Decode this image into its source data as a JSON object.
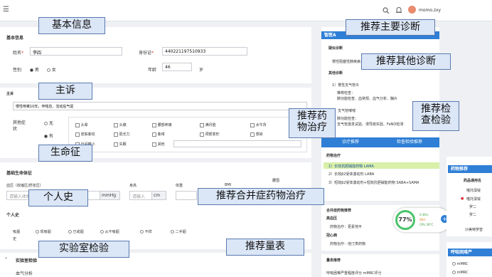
{
  "header": {
    "menu_icon": "menu-icon",
    "username": "momo.zxy",
    "icons": [
      "search-icon",
      "bell-icon",
      "avatar"
    ]
  },
  "basic_info": {
    "section_title": "基本信息",
    "name_label": "姓名",
    "name_required": "*",
    "name_value": "李四",
    "id_label": "身份证",
    "id_required": "*",
    "id_value": "440221197510933",
    "gender_label": "性别",
    "gender_male": "男",
    "gender_female": "女",
    "age_label": "年龄",
    "age_value": "46",
    "age_unit": "岁"
  },
  "complaint": {
    "section_title": "主诉",
    "value": "慢性咳嗽10年，伴喘息、活动后气促",
    "other_symptoms_label": "其他症状",
    "opt_none": "无",
    "opt_yes": "有",
    "symptoms": [
      "头晕",
      "头痛",
      "腰部疼痛",
      "满月脸",
      "水牛背",
      "皮肤紫纹",
      "肌无力",
      "紫绀",
      "颈部变形",
      "感染",
      "日间嗜小",
      "失眠",
      "其他"
    ]
  },
  "vitals": {
    "section_title": "基础生命体征",
    "bp_label": "血压（收缩压/舒张压）",
    "bp_placeholder": "请输入收缩压/舒张压",
    "bp_unit": "mmHg",
    "height_label": "身高",
    "height_placeholder": "请输入",
    "height_unit": "cm",
    "weight_label": "体重",
    "bmi_label": "BMI",
    "waist_label": "腰围"
  },
  "personal_history": {
    "section_title": "个人史",
    "smoking_label": "吸烟史",
    "options": [
      "现吸烟",
      "已戒烟",
      "从不吸烟",
      "不祥",
      "二手烟"
    ]
  },
  "lab": {
    "section_title": "实验室检验",
    "blood_gas": "血气分析"
  },
  "right_panel": {
    "ai_title": "智医A",
    "main_diag_label": "疑似诊断",
    "main_diag_value": "慢性阻塞性肺疾病",
    "other_diag_label": "其他诊断",
    "other_diag_item": "1）慢性支气管炎",
    "recommend_check": "推荐检查：",
    "check_list": "肺功能检查、血常规、血气分析、胸片",
    "other_diag_item2": "2）支气管哮喘",
    "check_list2": "肺功能检查：",
    "check_list3": "支气管激发试验、诱导痰实验、FeNO检测",
    "tab_drug": "诊疗推荐",
    "tab_exam": "检查检验推荐",
    "drug_section": "药物治疗",
    "drugs": [
      "1）长效抗胆碱能药物 LAMA",
      "2）长效β2受体激动剂 LABA",
      "3）短效β2受体激动剂+短效抗胆碱能药物 SABA+SAMA"
    ],
    "comorbid_section": "合并症药物推荐",
    "hypertension": "高血压",
    "hypertension_drug": "药物治疗：更素地平",
    "heart": "冠心病",
    "heart_drug": "药物治疗：他汀类药物",
    "scale_section": "量表推荐",
    "scale_item": "呼吸困难严重程度评分 mMRC评分"
  },
  "far_right": {
    "title": "药物推荐",
    "subtitle": "药品通用名",
    "items": [
      "噻托溴铵",
      "噻托溴铵",
      "罗二",
      "罗二",
      "沙美特罗替"
    ],
    "bottom_title": "呼吸困难严",
    "options": [
      "mMRC",
      "mMRC"
    ]
  },
  "widget": {
    "percent": "77%",
    "net_up": "0.4K/s",
    "net_down": "0K/s",
    "cpu": "CPU 39°C"
  },
  "callouts": {
    "basic": "基本信息",
    "complaint": "主诉",
    "vitals": "生命征",
    "personal": "个人史",
    "lab": "实验室检验",
    "main_diag": "推荐主要诊断",
    "other_diag": "推荐其他诊断",
    "drug": "推荐药\n物治疗",
    "exam": "推荐检\n查检验",
    "comorbid": "推荐合并症药物治疗",
    "scale": "推荐量表"
  }
}
